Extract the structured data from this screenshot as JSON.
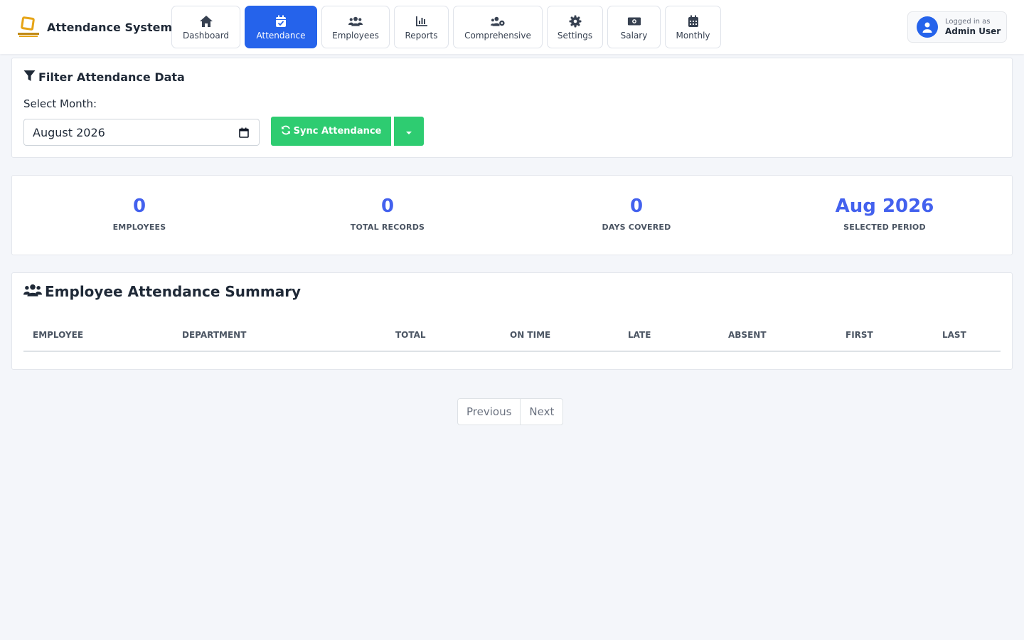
{
  "app": {
    "title": "Attendance System"
  },
  "nav": [
    {
      "label": "Dashboard",
      "icon": "home-icon"
    },
    {
      "label": "Attendance",
      "icon": "calendar-check-icon",
      "active": true
    },
    {
      "label": "Employees",
      "icon": "users-icon"
    },
    {
      "label": "Reports",
      "icon": "chart-bar-icon"
    },
    {
      "label": "Comprehensive",
      "icon": "users-cog-icon"
    },
    {
      "label": "Settings",
      "icon": "gear-icon"
    },
    {
      "label": "Salary",
      "icon": "money-icon"
    },
    {
      "label": "Monthly",
      "icon": "calendar-icon"
    }
  ],
  "user": {
    "caption": "Logged in as",
    "name": "Admin User"
  },
  "filter": {
    "title": "Filter Attendance Data",
    "month_label": "Select Month:",
    "month_value": "August 2026",
    "sync_label": "Sync Attendance"
  },
  "stats": [
    {
      "value": "0",
      "label": "EMPLOYEES"
    },
    {
      "value": "0",
      "label": "TOTAL RECORDS"
    },
    {
      "value": "0",
      "label": "DAYS COVERED"
    },
    {
      "value": "Aug 2026",
      "label": "SELECTED PERIOD"
    }
  ],
  "summary": {
    "title": "Employee Attendance Summary",
    "columns": [
      "EMPLOYEE",
      "DEPARTMENT",
      "TOTAL",
      "ON TIME",
      "LATE",
      "ABSENT",
      "FIRST",
      "LAST"
    ],
    "rows": []
  },
  "pagination": {
    "previous": "Previous",
    "next": "Next"
  },
  "colors": {
    "primary": "#2563eb",
    "accent": "#4361ee",
    "success": "#2ecc71"
  }
}
